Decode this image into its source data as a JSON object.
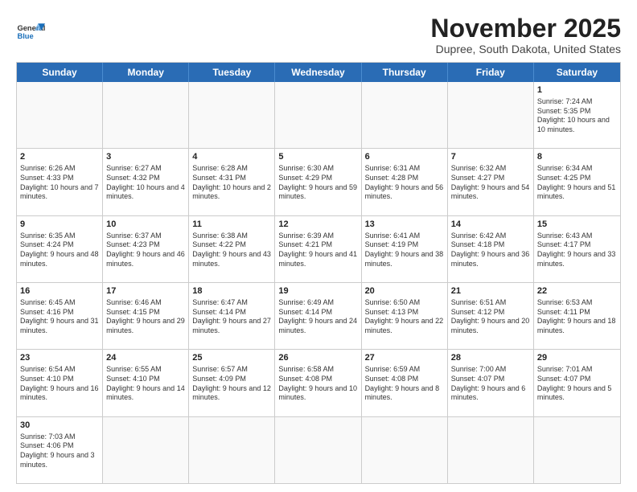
{
  "header": {
    "logo_general": "General",
    "logo_blue": "Blue",
    "month_title": "November 2025",
    "location": "Dupree, South Dakota, United States"
  },
  "days_of_week": [
    "Sunday",
    "Monday",
    "Tuesday",
    "Wednesday",
    "Thursday",
    "Friday",
    "Saturday"
  ],
  "rows": [
    [
      {
        "day": "",
        "info": ""
      },
      {
        "day": "",
        "info": ""
      },
      {
        "day": "",
        "info": ""
      },
      {
        "day": "",
        "info": ""
      },
      {
        "day": "",
        "info": ""
      },
      {
        "day": "",
        "info": ""
      },
      {
        "day": "1",
        "info": "Sunrise: 7:24 AM\nSunset: 5:35 PM\nDaylight: 10 hours and 10 minutes."
      }
    ],
    [
      {
        "day": "2",
        "info": "Sunrise: 6:26 AM\nSunset: 4:33 PM\nDaylight: 10 hours and 7 minutes."
      },
      {
        "day": "3",
        "info": "Sunrise: 6:27 AM\nSunset: 4:32 PM\nDaylight: 10 hours and 4 minutes."
      },
      {
        "day": "4",
        "info": "Sunrise: 6:28 AM\nSunset: 4:31 PM\nDaylight: 10 hours and 2 minutes."
      },
      {
        "day": "5",
        "info": "Sunrise: 6:30 AM\nSunset: 4:29 PM\nDaylight: 9 hours and 59 minutes."
      },
      {
        "day": "6",
        "info": "Sunrise: 6:31 AM\nSunset: 4:28 PM\nDaylight: 9 hours and 56 minutes."
      },
      {
        "day": "7",
        "info": "Sunrise: 6:32 AM\nSunset: 4:27 PM\nDaylight: 9 hours and 54 minutes."
      },
      {
        "day": "8",
        "info": "Sunrise: 6:34 AM\nSunset: 4:25 PM\nDaylight: 9 hours and 51 minutes."
      }
    ],
    [
      {
        "day": "9",
        "info": "Sunrise: 6:35 AM\nSunset: 4:24 PM\nDaylight: 9 hours and 48 minutes."
      },
      {
        "day": "10",
        "info": "Sunrise: 6:37 AM\nSunset: 4:23 PM\nDaylight: 9 hours and 46 minutes."
      },
      {
        "day": "11",
        "info": "Sunrise: 6:38 AM\nSunset: 4:22 PM\nDaylight: 9 hours and 43 minutes."
      },
      {
        "day": "12",
        "info": "Sunrise: 6:39 AM\nSunset: 4:21 PM\nDaylight: 9 hours and 41 minutes."
      },
      {
        "day": "13",
        "info": "Sunrise: 6:41 AM\nSunset: 4:19 PM\nDaylight: 9 hours and 38 minutes."
      },
      {
        "day": "14",
        "info": "Sunrise: 6:42 AM\nSunset: 4:18 PM\nDaylight: 9 hours and 36 minutes."
      },
      {
        "day": "15",
        "info": "Sunrise: 6:43 AM\nSunset: 4:17 PM\nDaylight: 9 hours and 33 minutes."
      }
    ],
    [
      {
        "day": "16",
        "info": "Sunrise: 6:45 AM\nSunset: 4:16 PM\nDaylight: 9 hours and 31 minutes."
      },
      {
        "day": "17",
        "info": "Sunrise: 6:46 AM\nSunset: 4:15 PM\nDaylight: 9 hours and 29 minutes."
      },
      {
        "day": "18",
        "info": "Sunrise: 6:47 AM\nSunset: 4:14 PM\nDaylight: 9 hours and 27 minutes."
      },
      {
        "day": "19",
        "info": "Sunrise: 6:49 AM\nSunset: 4:14 PM\nDaylight: 9 hours and 24 minutes."
      },
      {
        "day": "20",
        "info": "Sunrise: 6:50 AM\nSunset: 4:13 PM\nDaylight: 9 hours and 22 minutes."
      },
      {
        "day": "21",
        "info": "Sunrise: 6:51 AM\nSunset: 4:12 PM\nDaylight: 9 hours and 20 minutes."
      },
      {
        "day": "22",
        "info": "Sunrise: 6:53 AM\nSunset: 4:11 PM\nDaylight: 9 hours and 18 minutes."
      }
    ],
    [
      {
        "day": "23",
        "info": "Sunrise: 6:54 AM\nSunset: 4:10 PM\nDaylight: 9 hours and 16 minutes."
      },
      {
        "day": "24",
        "info": "Sunrise: 6:55 AM\nSunset: 4:10 PM\nDaylight: 9 hours and 14 minutes."
      },
      {
        "day": "25",
        "info": "Sunrise: 6:57 AM\nSunset: 4:09 PM\nDaylight: 9 hours and 12 minutes."
      },
      {
        "day": "26",
        "info": "Sunrise: 6:58 AM\nSunset: 4:08 PM\nDaylight: 9 hours and 10 minutes."
      },
      {
        "day": "27",
        "info": "Sunrise: 6:59 AM\nSunset: 4:08 PM\nDaylight: 9 hours and 8 minutes."
      },
      {
        "day": "28",
        "info": "Sunrise: 7:00 AM\nSunset: 4:07 PM\nDaylight: 9 hours and 6 minutes."
      },
      {
        "day": "29",
        "info": "Sunrise: 7:01 AM\nSunset: 4:07 PM\nDaylight: 9 hours and 5 minutes."
      }
    ],
    [
      {
        "day": "30",
        "info": "Sunrise: 7:03 AM\nSunset: 4:06 PM\nDaylight: 9 hours and 3 minutes."
      },
      {
        "day": "",
        "info": ""
      },
      {
        "day": "",
        "info": ""
      },
      {
        "day": "",
        "info": ""
      },
      {
        "day": "",
        "info": ""
      },
      {
        "day": "",
        "info": ""
      },
      {
        "day": "",
        "info": ""
      }
    ]
  ]
}
